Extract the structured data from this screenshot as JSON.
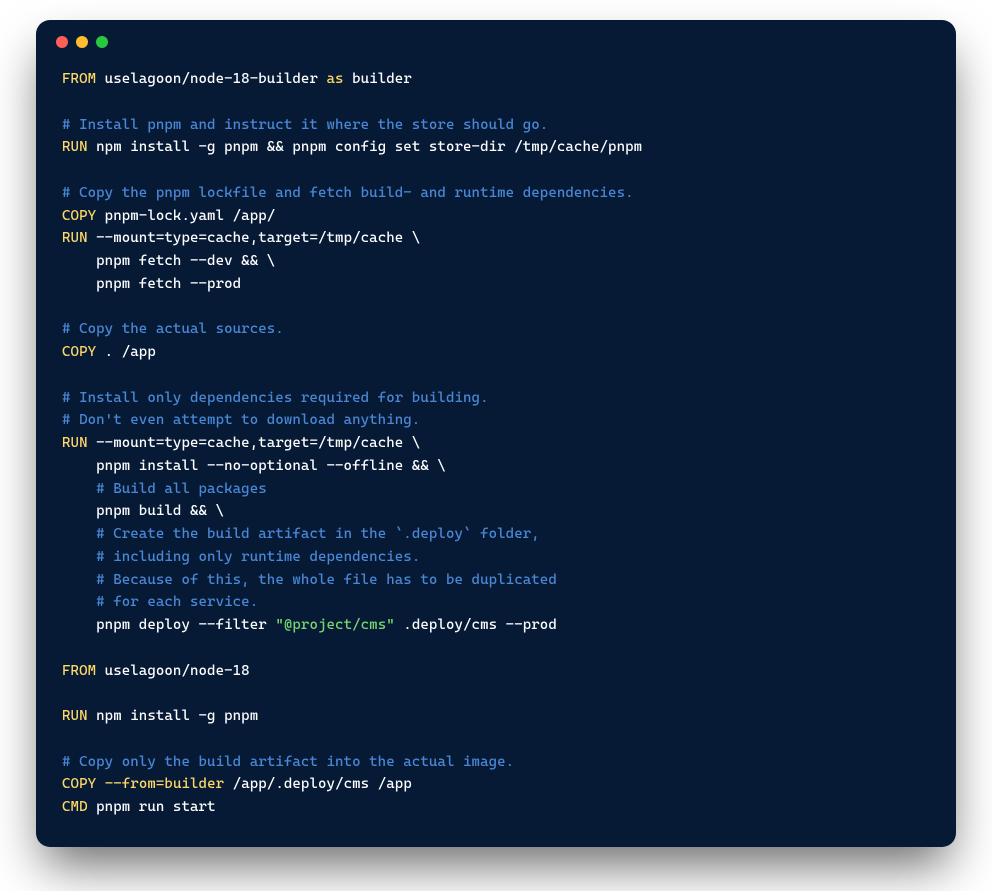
{
  "window": {
    "buttons": {
      "close": "close",
      "minimize": "minimize",
      "maximize": "maximize"
    }
  },
  "code": {
    "lines": [
      [
        {
          "cls": "t-kw",
          "v": "FROM"
        },
        {
          "cls": "t-pl",
          "v": " uselagoon/node-18-builder "
        },
        {
          "cls": "t-kw",
          "v": "as"
        },
        {
          "cls": "t-pl",
          "v": " builder"
        }
      ],
      [],
      [
        {
          "cls": "t-cm",
          "v": "# Install pnpm and instruct it where the store should go."
        }
      ],
      [
        {
          "cls": "t-kw",
          "v": "RUN"
        },
        {
          "cls": "t-pl",
          "v": " npm install -g pnpm && pnpm config set store-dir /tmp/cache/pnpm"
        }
      ],
      [],
      [
        {
          "cls": "t-cm",
          "v": "# Copy the pnpm lockfile and fetch build- and runtime dependencies."
        }
      ],
      [
        {
          "cls": "t-kw",
          "v": "COPY"
        },
        {
          "cls": "t-pl",
          "v": " pnpm-lock.yaml /app/"
        }
      ],
      [
        {
          "cls": "t-kw",
          "v": "RUN"
        },
        {
          "cls": "t-pl",
          "v": " --mount=type=cache,target=/tmp/cache \\"
        }
      ],
      [
        {
          "cls": "t-pl",
          "v": "    pnpm fetch --dev && \\"
        }
      ],
      [
        {
          "cls": "t-pl",
          "v": "    pnpm fetch --prod"
        }
      ],
      [],
      [
        {
          "cls": "t-cm",
          "v": "# Copy the actual sources."
        }
      ],
      [
        {
          "cls": "t-kw",
          "v": "COPY"
        },
        {
          "cls": "t-pl",
          "v": " . /app"
        }
      ],
      [],
      [
        {
          "cls": "t-cm",
          "v": "# Install only dependencies required for building."
        }
      ],
      [
        {
          "cls": "t-cm",
          "v": "# Don't even attempt to download anything."
        }
      ],
      [
        {
          "cls": "t-kw",
          "v": "RUN"
        },
        {
          "cls": "t-pl",
          "v": " --mount=type=cache,target=/tmp/cache \\"
        }
      ],
      [
        {
          "cls": "t-pl",
          "v": "    pnpm install --no-optional --offline && \\"
        }
      ],
      [
        {
          "cls": "t-pl",
          "v": "    "
        },
        {
          "cls": "t-cm",
          "v": "# Build all packages"
        }
      ],
      [
        {
          "cls": "t-pl",
          "v": "    pnpm build && \\"
        }
      ],
      [
        {
          "cls": "t-pl",
          "v": "    "
        },
        {
          "cls": "t-cm",
          "v": "# Create the build artifact in the `.deploy` folder,"
        }
      ],
      [
        {
          "cls": "t-pl",
          "v": "    "
        },
        {
          "cls": "t-cm",
          "v": "# including only runtime dependencies."
        }
      ],
      [
        {
          "cls": "t-pl",
          "v": "    "
        },
        {
          "cls": "t-cm",
          "v": "# Because of this, the whole file has to be duplicated"
        }
      ],
      [
        {
          "cls": "t-pl",
          "v": "    "
        },
        {
          "cls": "t-cm",
          "v": "# for each service."
        }
      ],
      [
        {
          "cls": "t-pl",
          "v": "    pnpm deploy --filter "
        },
        {
          "cls": "t-str",
          "v": "\"@project/cms\""
        },
        {
          "cls": "t-pl",
          "v": " .deploy/cms --prod"
        }
      ],
      [],
      [
        {
          "cls": "t-kw",
          "v": "FROM"
        },
        {
          "cls": "t-pl",
          "v": " uselagoon/node-18"
        }
      ],
      [],
      [
        {
          "cls": "t-kw",
          "v": "RUN"
        },
        {
          "cls": "t-pl",
          "v": " npm install -g pnpm"
        }
      ],
      [],
      [
        {
          "cls": "t-cm",
          "v": "# Copy only the build artifact into the actual image."
        }
      ],
      [
        {
          "cls": "t-kw",
          "v": "COPY"
        },
        {
          "cls": "t-pl",
          "v": " "
        },
        {
          "cls": "t-kw",
          "v": "--from=builder"
        },
        {
          "cls": "t-pl",
          "v": " /app/.deploy/cms /app"
        }
      ],
      [
        {
          "cls": "t-kw",
          "v": "CMD"
        },
        {
          "cls": "t-pl",
          "v": " pnpm run start"
        }
      ]
    ]
  }
}
